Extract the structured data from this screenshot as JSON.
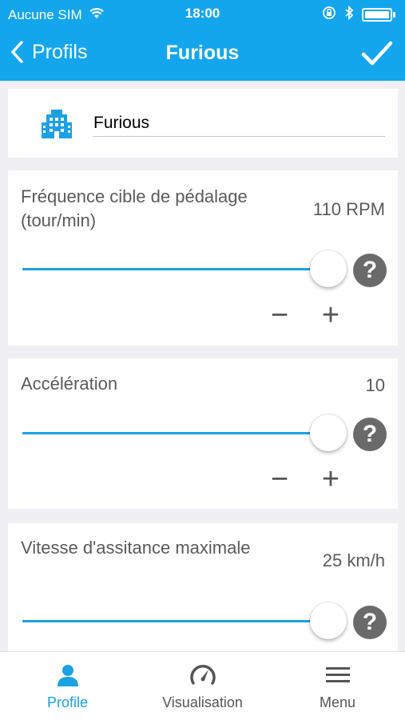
{
  "status_bar": {
    "carrier": "Aucune SIM",
    "time": "18:00"
  },
  "nav": {
    "back_label": "Profils",
    "title": "Furious"
  },
  "profile_name": {
    "value": "Furious"
  },
  "settings": [
    {
      "label": "Fréquence cible de pédalage (tour/min)",
      "value": "110 RPM",
      "slider_fraction": 1.0
    },
    {
      "label": "Accélération",
      "value": "10",
      "slider_fraction": 1.0
    },
    {
      "label": "Vitesse d'assitance maximale",
      "value": "25 km/h",
      "slider_fraction": 1.0
    }
  ],
  "help_glyph": "?",
  "minus_glyph": "−",
  "plus_glyph": "+",
  "tabs": [
    {
      "label": "Profile",
      "icon": "person-icon",
      "active": true
    },
    {
      "label": "Visualisation",
      "icon": "speedometer-icon",
      "active": false
    },
    {
      "label": "Menu",
      "icon": "hamburger-icon",
      "active": false
    }
  ],
  "colors": {
    "accent": "#13a6ec",
    "help": "#6a6a6a"
  }
}
